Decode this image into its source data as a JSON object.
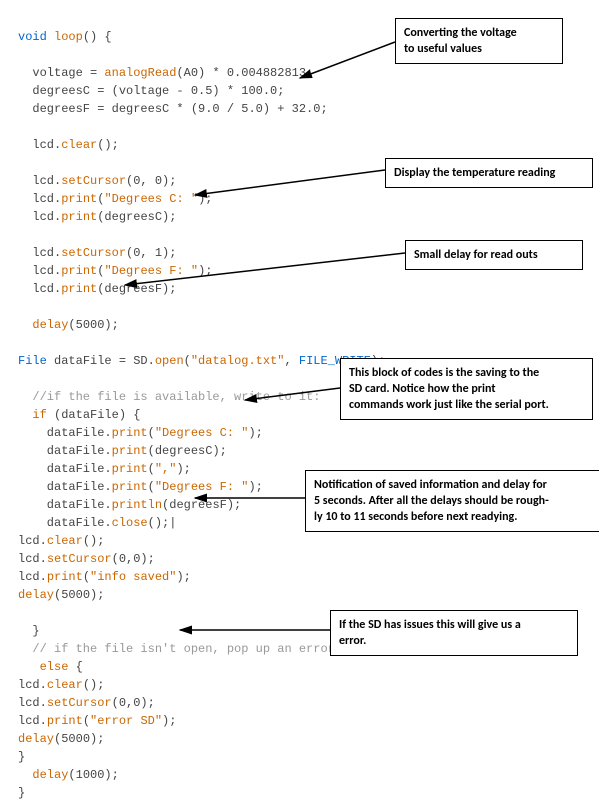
{
  "code": {
    "l1_void": "void",
    "l1_loop": "loop",
    "l1_rest": "() {",
    "l2_a": "  voltage = ",
    "l2_fn": "analogRead",
    "l2_b": "(A0) * 0.004882813;",
    "l3": "  degreesC = (voltage - 0.5) * 100.0;",
    "l4": "  degreesF = degreesC * (9.0 / 5.0) + 32.0;",
    "l5_a": "  lcd.",
    "l5_fn": "clear",
    "l5_b": "();",
    "l6_a": "  lcd.",
    "l6_fn": "setCursor",
    "l6_b": "(0, 0);",
    "l7_a": "  lcd.",
    "l7_fn": "print",
    "l7_b": "(",
    "l7_str": "\"Degrees C: \"",
    "l7_c": ");",
    "l8_a": "  lcd.",
    "l8_fn": "print",
    "l8_b": "(degreesC);",
    "l9_a": "  lcd.",
    "l9_fn": "setCursor",
    "l9_b": "(0, 1);",
    "l10_a": "  lcd.",
    "l10_fn": "print",
    "l10_b": "(",
    "l10_str": "\"Degrees F: \"",
    "l10_c": ");",
    "l11_a": "  lcd.",
    "l11_fn": "print",
    "l11_b": "(degreesF);",
    "l12_a": "  ",
    "l12_fn": "delay",
    "l12_b": "(5000);",
    "l13_type": "File",
    "l13_a": " dataFile = SD.",
    "l13_fn": "open",
    "l13_b": "(",
    "l13_str": "\"datalog.txt\"",
    "l13_c": ", ",
    "l13_const": "FILE_WRITE",
    "l13_d": ");",
    "l14": "  //if the file is available, write to it:",
    "l15_a": "  ",
    "l15_if": "if",
    "l15_b": " (dataFile) {",
    "l16_a": "    dataFile.",
    "l16_fn": "print",
    "l16_b": "(",
    "l16_str": "\"Degrees C: \"",
    "l16_c": ");",
    "l17_a": "    dataFile.",
    "l17_fn": "print",
    "l17_b": "(degreesC);",
    "l18_a": "    dataFile.",
    "l18_fn": "print",
    "l18_b": "(",
    "l18_str": "\",\"",
    "l18_c": ");",
    "l19_a": "    dataFile.",
    "l19_fn": "print",
    "l19_b": "(",
    "l19_str": "\"Degrees F: \"",
    "l19_c": ");",
    "l20_a": "    dataFile.",
    "l20_fn": "println",
    "l20_b": "(degreesF);",
    "l21_a": "    dataFile.",
    "l21_fn": "close",
    "l21_b": "();|",
    "l22_a": "lcd.",
    "l22_fn": "clear",
    "l22_b": "();",
    "l23_a": "lcd.",
    "l23_fn": "setCursor",
    "l23_b": "(0,0);",
    "l24_a": "lcd.",
    "l24_fn": "print",
    "l24_b": "(",
    "l24_str": "\"info saved\"",
    "l24_c": ");",
    "l25_fn": "delay",
    "l25_b": "(5000);",
    "l26": "  }",
    "l27": "  // if the file isn't open, pop up an error:",
    "l28_a": "   ",
    "l28_else": "else",
    "l28_b": " {",
    "l29_a": "lcd.",
    "l29_fn": "clear",
    "l29_b": "();",
    "l30_a": "lcd.",
    "l30_fn": "setCursor",
    "l30_b": "(0,0);",
    "l31_a": "lcd.",
    "l31_fn": "print",
    "l31_b": "(",
    "l31_str": "\"error SD\"",
    "l31_c": ");",
    "l32_fn": "delay",
    "l32_b": "(5000);",
    "l33": "}",
    "l34_a": "  ",
    "l34_fn": "delay",
    "l34_b": "(1000);",
    "l35": "}"
  },
  "annotations": {
    "a1_l1": "Converting the voltage",
    "a1_l2": "to useful values",
    "a2": "Display the temperature reading",
    "a3": "Small delay for read outs",
    "a4_l1": "This block of codes is the saving to the",
    "a4_l2": "SD card. Notice how the print",
    "a4_l3": "commands work just like the serial port.",
    "a5_l1": "Notification of saved information and delay for",
    "a5_l2": "5 seconds. After all the delays should be rough-",
    "a5_l3": "ly 10 to 11 seconds before next readying.",
    "a6_l1": "If the SD has issues this will give us a",
    "a6_l2": "error."
  }
}
